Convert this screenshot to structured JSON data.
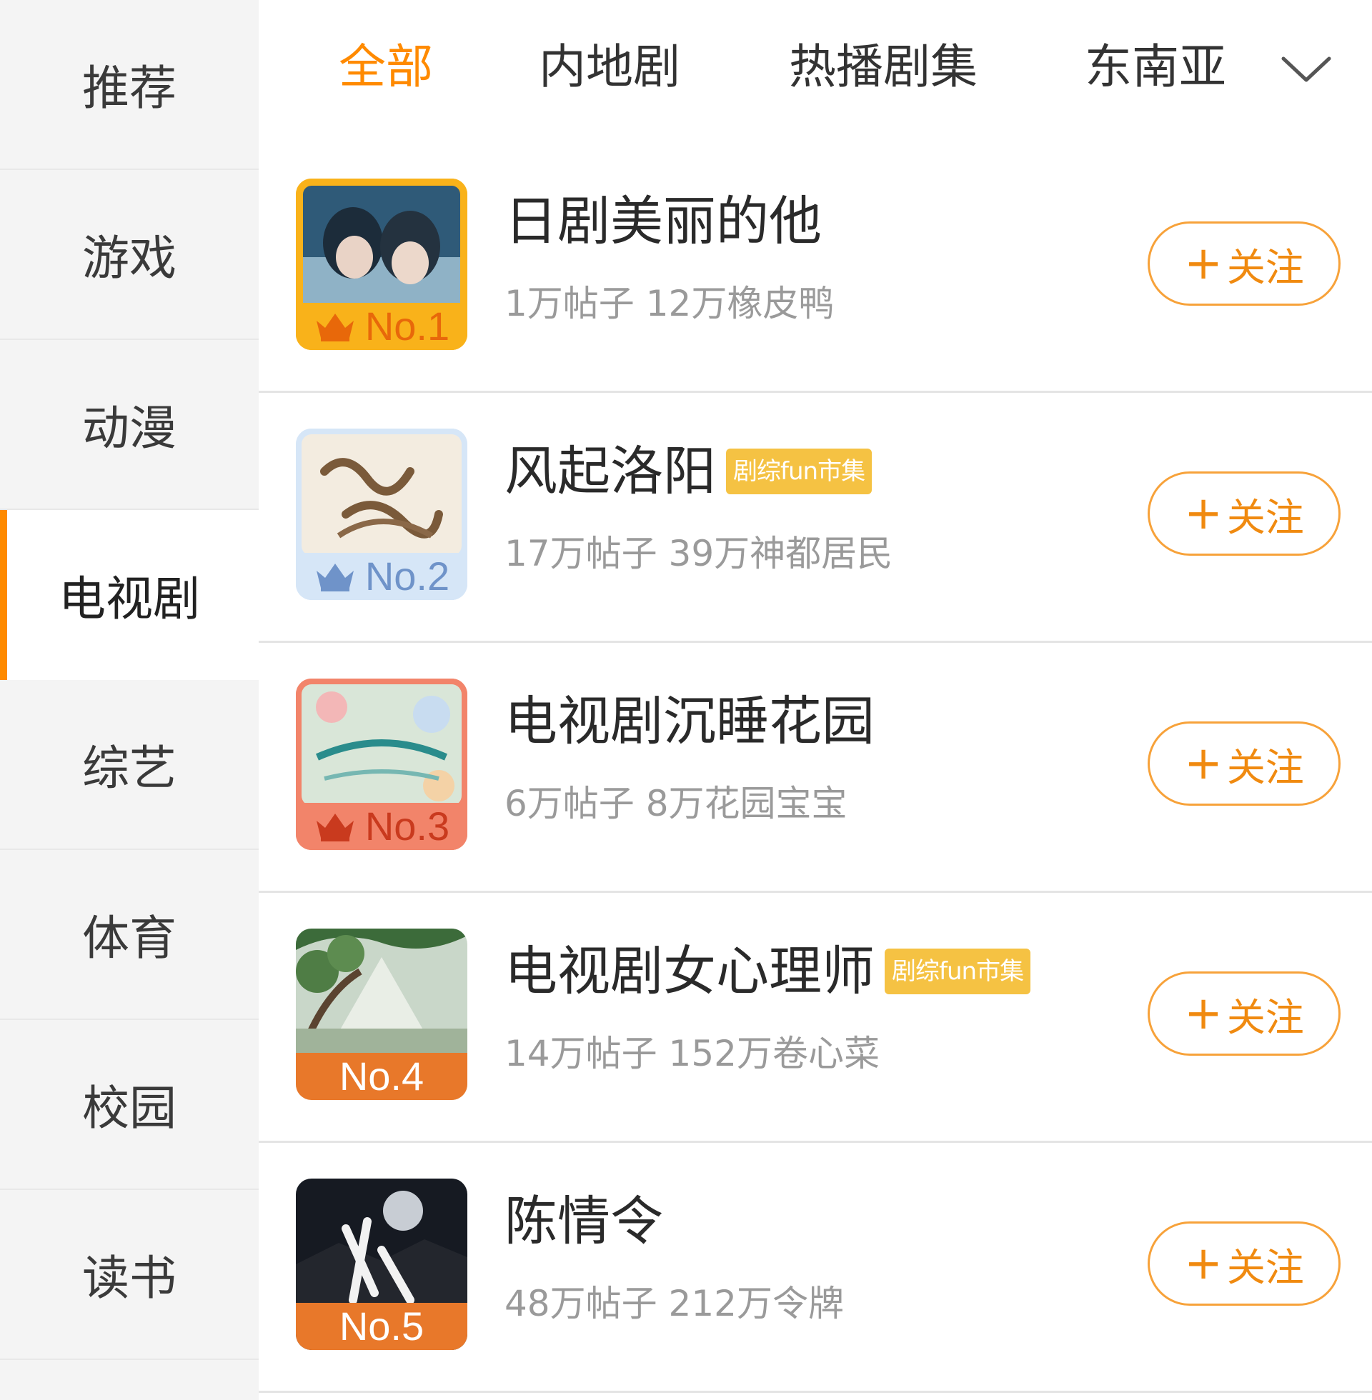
{
  "sidebar": {
    "items": [
      {
        "label": "推荐"
      },
      {
        "label": "游戏"
      },
      {
        "label": "动漫"
      },
      {
        "label": "电视剧"
      },
      {
        "label": "综艺"
      },
      {
        "label": "体育"
      },
      {
        "label": "校园"
      },
      {
        "label": "读书"
      }
    ],
    "active_index": 3
  },
  "tabs": [
    {
      "label": "全部"
    },
    {
      "label": "内地剧"
    },
    {
      "label": "热播剧集"
    },
    {
      "label": "东南亚"
    }
  ],
  "tabs_more_icon": "chevron-down-icon",
  "colors": {
    "accent": "#ff8a00",
    "rank1": "#f9b21a",
    "rank2": "#d6e6f7",
    "rank3": "#f2846a",
    "rank_default": "#e8782a",
    "tag": "#f5c243"
  },
  "list": [
    {
      "rank": "No.1",
      "title": "日剧美丽的他",
      "tag": "",
      "stats": "1万帖子 12万橡皮鸭",
      "follow": "关注"
    },
    {
      "rank": "No.2",
      "title": "风起洛阳",
      "tag": "剧综fun市集",
      "stats": "17万帖子 39万神都居民",
      "follow": "关注"
    },
    {
      "rank": "No.3",
      "title": "电视剧沉睡花园",
      "tag": "",
      "stats": "6万帖子 8万花园宝宝",
      "follow": "关注"
    },
    {
      "rank": "No.4",
      "title": "电视剧女心理师",
      "tag": "剧综fun市集",
      "stats": "14万帖子 152万卷心菜",
      "follow": "关注"
    },
    {
      "rank": "No.5",
      "title": "陈情令",
      "tag": "",
      "stats": "48万帖子 212万令牌",
      "follow": "关注"
    }
  ],
  "follow_plus": "+"
}
